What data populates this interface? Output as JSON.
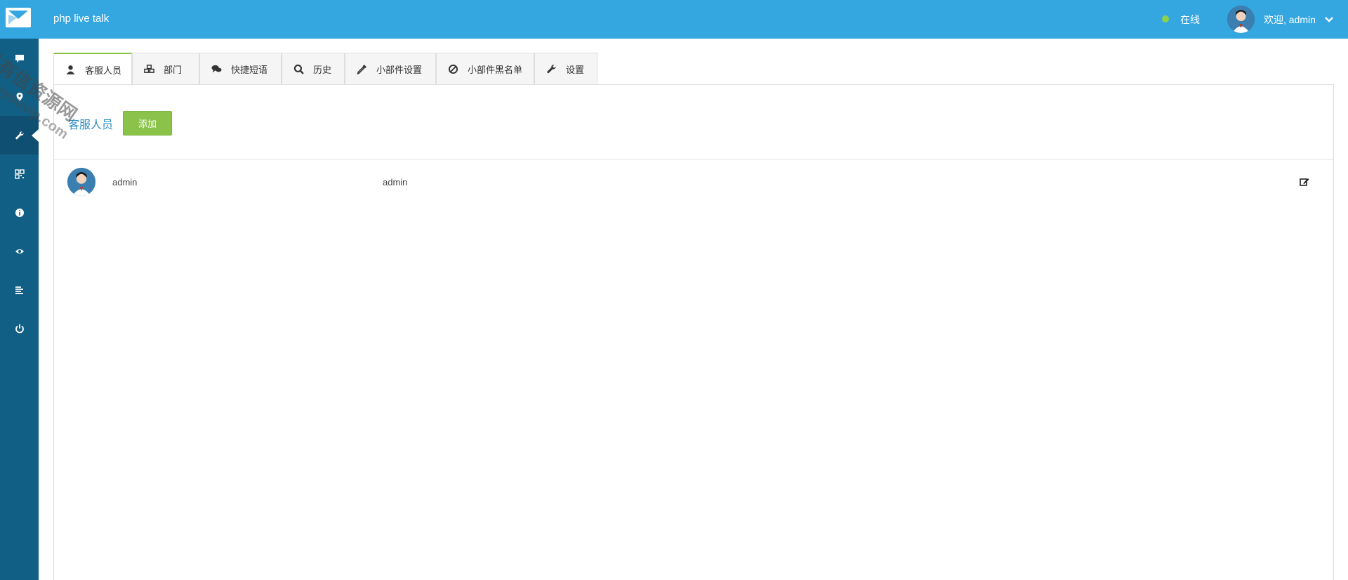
{
  "app": {
    "title": "php live talk",
    "status_text": "在线",
    "welcome_text": "欢迎, admin"
  },
  "colors": {
    "topbar": "#35a7e0",
    "sidebar": "#125f86",
    "sidebar_active": "#0e4f72",
    "accent_green": "#8bc34a",
    "link_blue": "#2a8bc0",
    "online_dot": "#8ed14a"
  },
  "sidebar": {
    "items": [
      {
        "icon": "chat-icon"
      },
      {
        "icon": "location-pin-icon"
      },
      {
        "icon": "wrench-icon",
        "active": true
      },
      {
        "icon": "qrcode-icon"
      },
      {
        "icon": "info-icon"
      },
      {
        "icon": "eye-icon"
      },
      {
        "icon": "list-icon"
      },
      {
        "icon": "power-icon"
      }
    ]
  },
  "tabs": [
    {
      "label": "客服人员",
      "icon": "user-icon",
      "active": true
    },
    {
      "label": "部门",
      "icon": "cubes-icon"
    },
    {
      "label": "快捷短语",
      "icon": "comments-icon"
    },
    {
      "label": "历史",
      "icon": "search-icon"
    },
    {
      "label": "小部件设置",
      "icon": "eyedropper-icon"
    },
    {
      "label": "小部件黑名单",
      "icon": "ban-icon"
    },
    {
      "label": "设置",
      "icon": "wrench-icon"
    }
  ],
  "main": {
    "section_title": "客服人员",
    "add_button": "添加",
    "agents": [
      {
        "name": "admin",
        "username": "admin",
        "action_icon": "edit-icon"
      }
    ]
  },
  "watermark": {
    "text": "易有信资源网",
    "subtext": "douyouvip.com"
  }
}
